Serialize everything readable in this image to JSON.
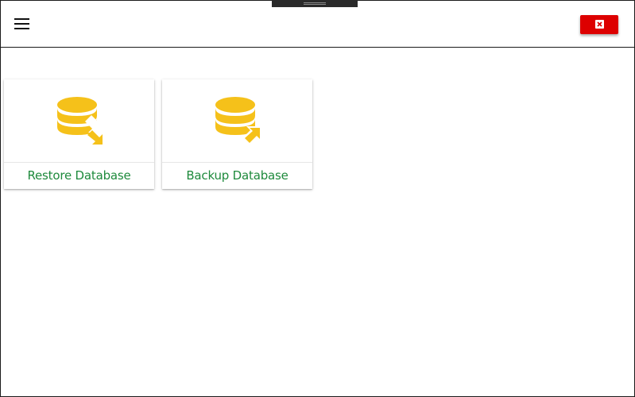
{
  "header": {
    "menu_icon": "hamburger-menu-icon",
    "close_icon": "close-x-icon",
    "close_button_color": "#dd0000"
  },
  "cards": [
    {
      "label": "Restore Database",
      "icon": "database-restore-icon"
    },
    {
      "label": "Backup Database",
      "icon": "database-backup-icon"
    }
  ],
  "colors": {
    "icon_yellow": "#f5c11a",
    "label_green": "#1e8a3c"
  }
}
